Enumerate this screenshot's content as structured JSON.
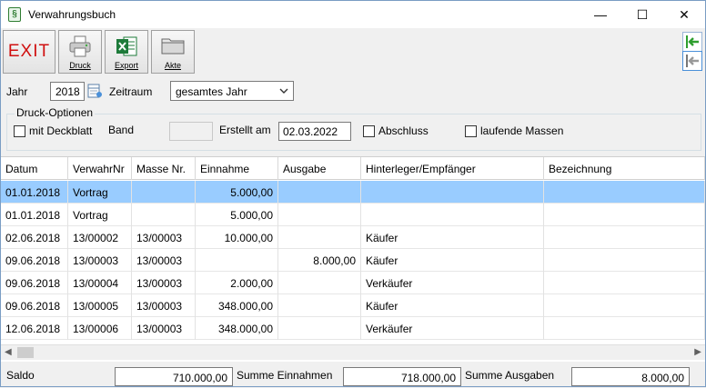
{
  "window": {
    "title": "Verwahrungsbuch",
    "app_icon": "§",
    "minimize_glyph": "—",
    "maximize_glyph": "☐",
    "close_glyph": "✕"
  },
  "toolbar": {
    "exit_label": "EXIT",
    "druck_label": "Druck",
    "export_label": "Export",
    "akte_label": "Akte"
  },
  "filters": {
    "jahr_label": "Jahr",
    "jahr_value": "2018",
    "zeitraum_label": "Zeitraum",
    "zeitraum_value": "gesamtes Jahr"
  },
  "druck_optionen": {
    "title": "Druck-Optionen",
    "mit_deckblatt": "mit Deckblatt",
    "band_label": "Band",
    "band_value": "",
    "erstellt_label": "Erstellt am",
    "erstellt_value": "02.03.2022",
    "abschluss": "Abschluss",
    "laufende_massen": "laufende Massen"
  },
  "table": {
    "columns": [
      "Datum",
      "VerwahrNr",
      "Masse Nr.",
      "Einnahme",
      "Ausgabe",
      "Hinterleger/Empfänger",
      "Bezeichnung"
    ],
    "rows": [
      [
        "01.01.2018",
        "Vortrag",
        "",
        "5.000,00",
        "",
        "",
        ""
      ],
      [
        "01.01.2018",
        "Vortrag",
        "",
        "5.000,00",
        "",
        "",
        ""
      ],
      [
        "02.06.2018",
        "13/00002",
        "13/00003",
        "10.000,00",
        "",
        "Käufer",
        ""
      ],
      [
        "09.06.2018",
        "13/00003",
        "13/00003",
        "",
        "8.000,00",
        "Käufer",
        ""
      ],
      [
        "09.06.2018",
        "13/00004",
        "13/00003",
        "2.000,00",
        "",
        "Verkäufer",
        ""
      ],
      [
        "09.06.2018",
        "13/00005",
        "13/00003",
        "348.000,00",
        "",
        "Käufer",
        ""
      ],
      [
        "12.06.2018",
        "13/00006",
        "13/00003",
        "348.000,00",
        "",
        "Verkäufer",
        ""
      ]
    ],
    "selected_row": 0
  },
  "footer": {
    "saldo_label": "Saldo",
    "saldo_value": "710.000,00",
    "summe_einnahmen_label": "Summe Einnahmen",
    "summe_einnahmen_value": "718.000,00",
    "summe_ausgaben_label": "Summe Ausgaben",
    "summe_ausgaben_value": "8.000,00"
  },
  "colors": {
    "selection": "#99ccff",
    "exit_text": "#d01010",
    "nav_arrow": "#2e9e2e"
  }
}
